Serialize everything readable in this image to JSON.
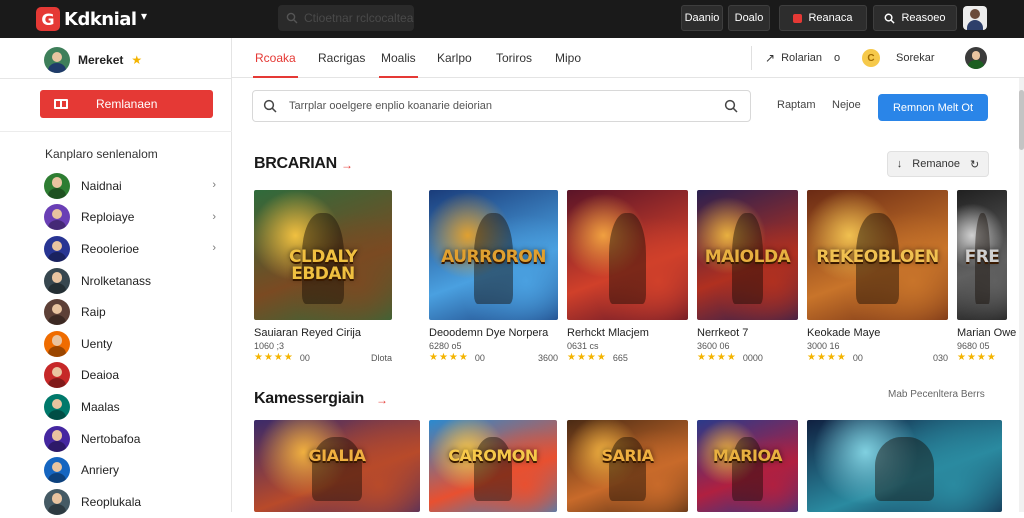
{
  "app": {
    "logo_letter": "G",
    "logo_text": "Kdknial"
  },
  "topbar": {
    "search_placeholder": "Ctioetnar rclcocaltea",
    "btn_1": "Daanio",
    "btn_2": "Doalo",
    "btn_3": "Reanaca",
    "btn_4": "Reasoeo"
  },
  "profile": {
    "name": "Mereket"
  },
  "sidebar": {
    "cta_label": "Remlanaen",
    "heading": "Kanplaro senlenalom",
    "items": [
      {
        "label": "Naidnai",
        "chevron": true,
        "color": "#2e7d32"
      },
      {
        "label": "Reploiaye",
        "chevron": true,
        "color": "#6a3fb5"
      },
      {
        "label": "Reoolerioe",
        "chevron": true,
        "color": "#283593"
      },
      {
        "label": "Nrolketanass",
        "chevron": false,
        "color": "#37474f"
      },
      {
        "label": "Raip",
        "chevron": false,
        "color": "#5d4037"
      },
      {
        "label": "Uenty",
        "chevron": false,
        "color": "#ef6c00"
      },
      {
        "label": "Deaioa",
        "chevron": false,
        "color": "#c62828"
      },
      {
        "label": "Maalas",
        "chevron": false,
        "color": "#00796b"
      },
      {
        "label": "Nertobafoa",
        "chevron": false,
        "color": "#4527a0"
      },
      {
        "label": "Anriery",
        "chevron": false,
        "color": "#1565c0"
      },
      {
        "label": "Reoplukala",
        "chevron": false,
        "color": "#455a64"
      }
    ]
  },
  "tabs": [
    {
      "label": "Rcoaka",
      "active": true
    },
    {
      "label": "Racrigas",
      "active": false
    },
    {
      "label": "Moalis",
      "active": false
    },
    {
      "label": "Karlpo",
      "active": false
    },
    {
      "label": "Toriros",
      "active": false
    },
    {
      "label": "Mipo",
      "active": false
    }
  ],
  "subnav_right": {
    "item_1": "Rolarian",
    "item_1_suffix": "o",
    "coin_label": "C",
    "item_2": "Sorekar"
  },
  "search": {
    "placeholder": "Tarrplar ooelgere enplio koanarie deiorian",
    "link_1": "Raptam",
    "link_2": "Nejoe",
    "primary_button": "Remnon Melt Ot"
  },
  "section_1": {
    "title": "BRCARIAN",
    "arrow": "→",
    "button_label": "Remanoe",
    "cards": [
      {
        "thumb_text": "CLDALY EBDAN",
        "name": "Sauiaran Reyed Cirija",
        "sub": "1060 ;3",
        "rating": "00",
        "right": "Dlota",
        "bg": [
          "#2f6b3c",
          "#7a4a22",
          "#f0c040"
        ]
      },
      {
        "thumb_text": "AURRORON",
        "name": "Deoodemn Dye Norpera",
        "sub": "6280 o5",
        "rating": "00",
        "right": "3600",
        "bg": [
          "#1a3c7a",
          "#4aa0e0",
          "#e0a030"
        ]
      },
      {
        "thumb_text": "",
        "name": "Rerhckt Mlacjem",
        "sub": "0631 cs",
        "rating": "665",
        "right": "",
        "bg": [
          "#5a1428",
          "#d0402a",
          "#f0a040"
        ]
      },
      {
        "thumb_text": "MAIOLDA",
        "name": "Nerrkeot 7",
        "sub": "3600 06",
        "rating": "0000",
        "right": "",
        "bg": [
          "#2a2050",
          "#b03020",
          "#e8b040"
        ]
      },
      {
        "thumb_text": "REKEOBLOEN",
        "name": "Keokade Maye",
        "sub": "3000 16",
        "rating": "00",
        "right": "030",
        "bg": [
          "#6a2a14",
          "#c8742a",
          "#f0c050"
        ]
      },
      {
        "thumb_text": "FRE",
        "name": "Marian Owe",
        "sub": "9680 05",
        "rating": "",
        "right": "",
        "bg": [
          "#202020",
          "#606060",
          "#d0d0d0"
        ]
      }
    ]
  },
  "section_2": {
    "title": "Kamessergiain",
    "arrow": "→",
    "link": "Mab Pecenltera Berrs",
    "cards": [
      {
        "thumb_text": "GIALIA",
        "bg": [
          "#3a2a6a",
          "#b84a2a",
          "#f0b040"
        ]
      },
      {
        "thumb_text": "CAROMON",
        "bg": [
          "#2a8ad0",
          "#e85030",
          "#f6c84a"
        ]
      },
      {
        "thumb_text": "SARIA",
        "bg": [
          "#4a2a14",
          "#c86a2a",
          "#f0b040"
        ]
      },
      {
        "thumb_text": "MARIOA",
        "bg": [
          "#2a3a8a",
          "#b02040",
          "#e8b040"
        ]
      },
      {
        "thumb_text": "",
        "bg": [
          "#102040",
          "#2a8aa0",
          "#80d0e0"
        ]
      }
    ]
  },
  "colors": {
    "accent": "#e53935",
    "primary": "#2a85e8",
    "topbar": "#1a1a1a",
    "star": "#f4b400"
  }
}
